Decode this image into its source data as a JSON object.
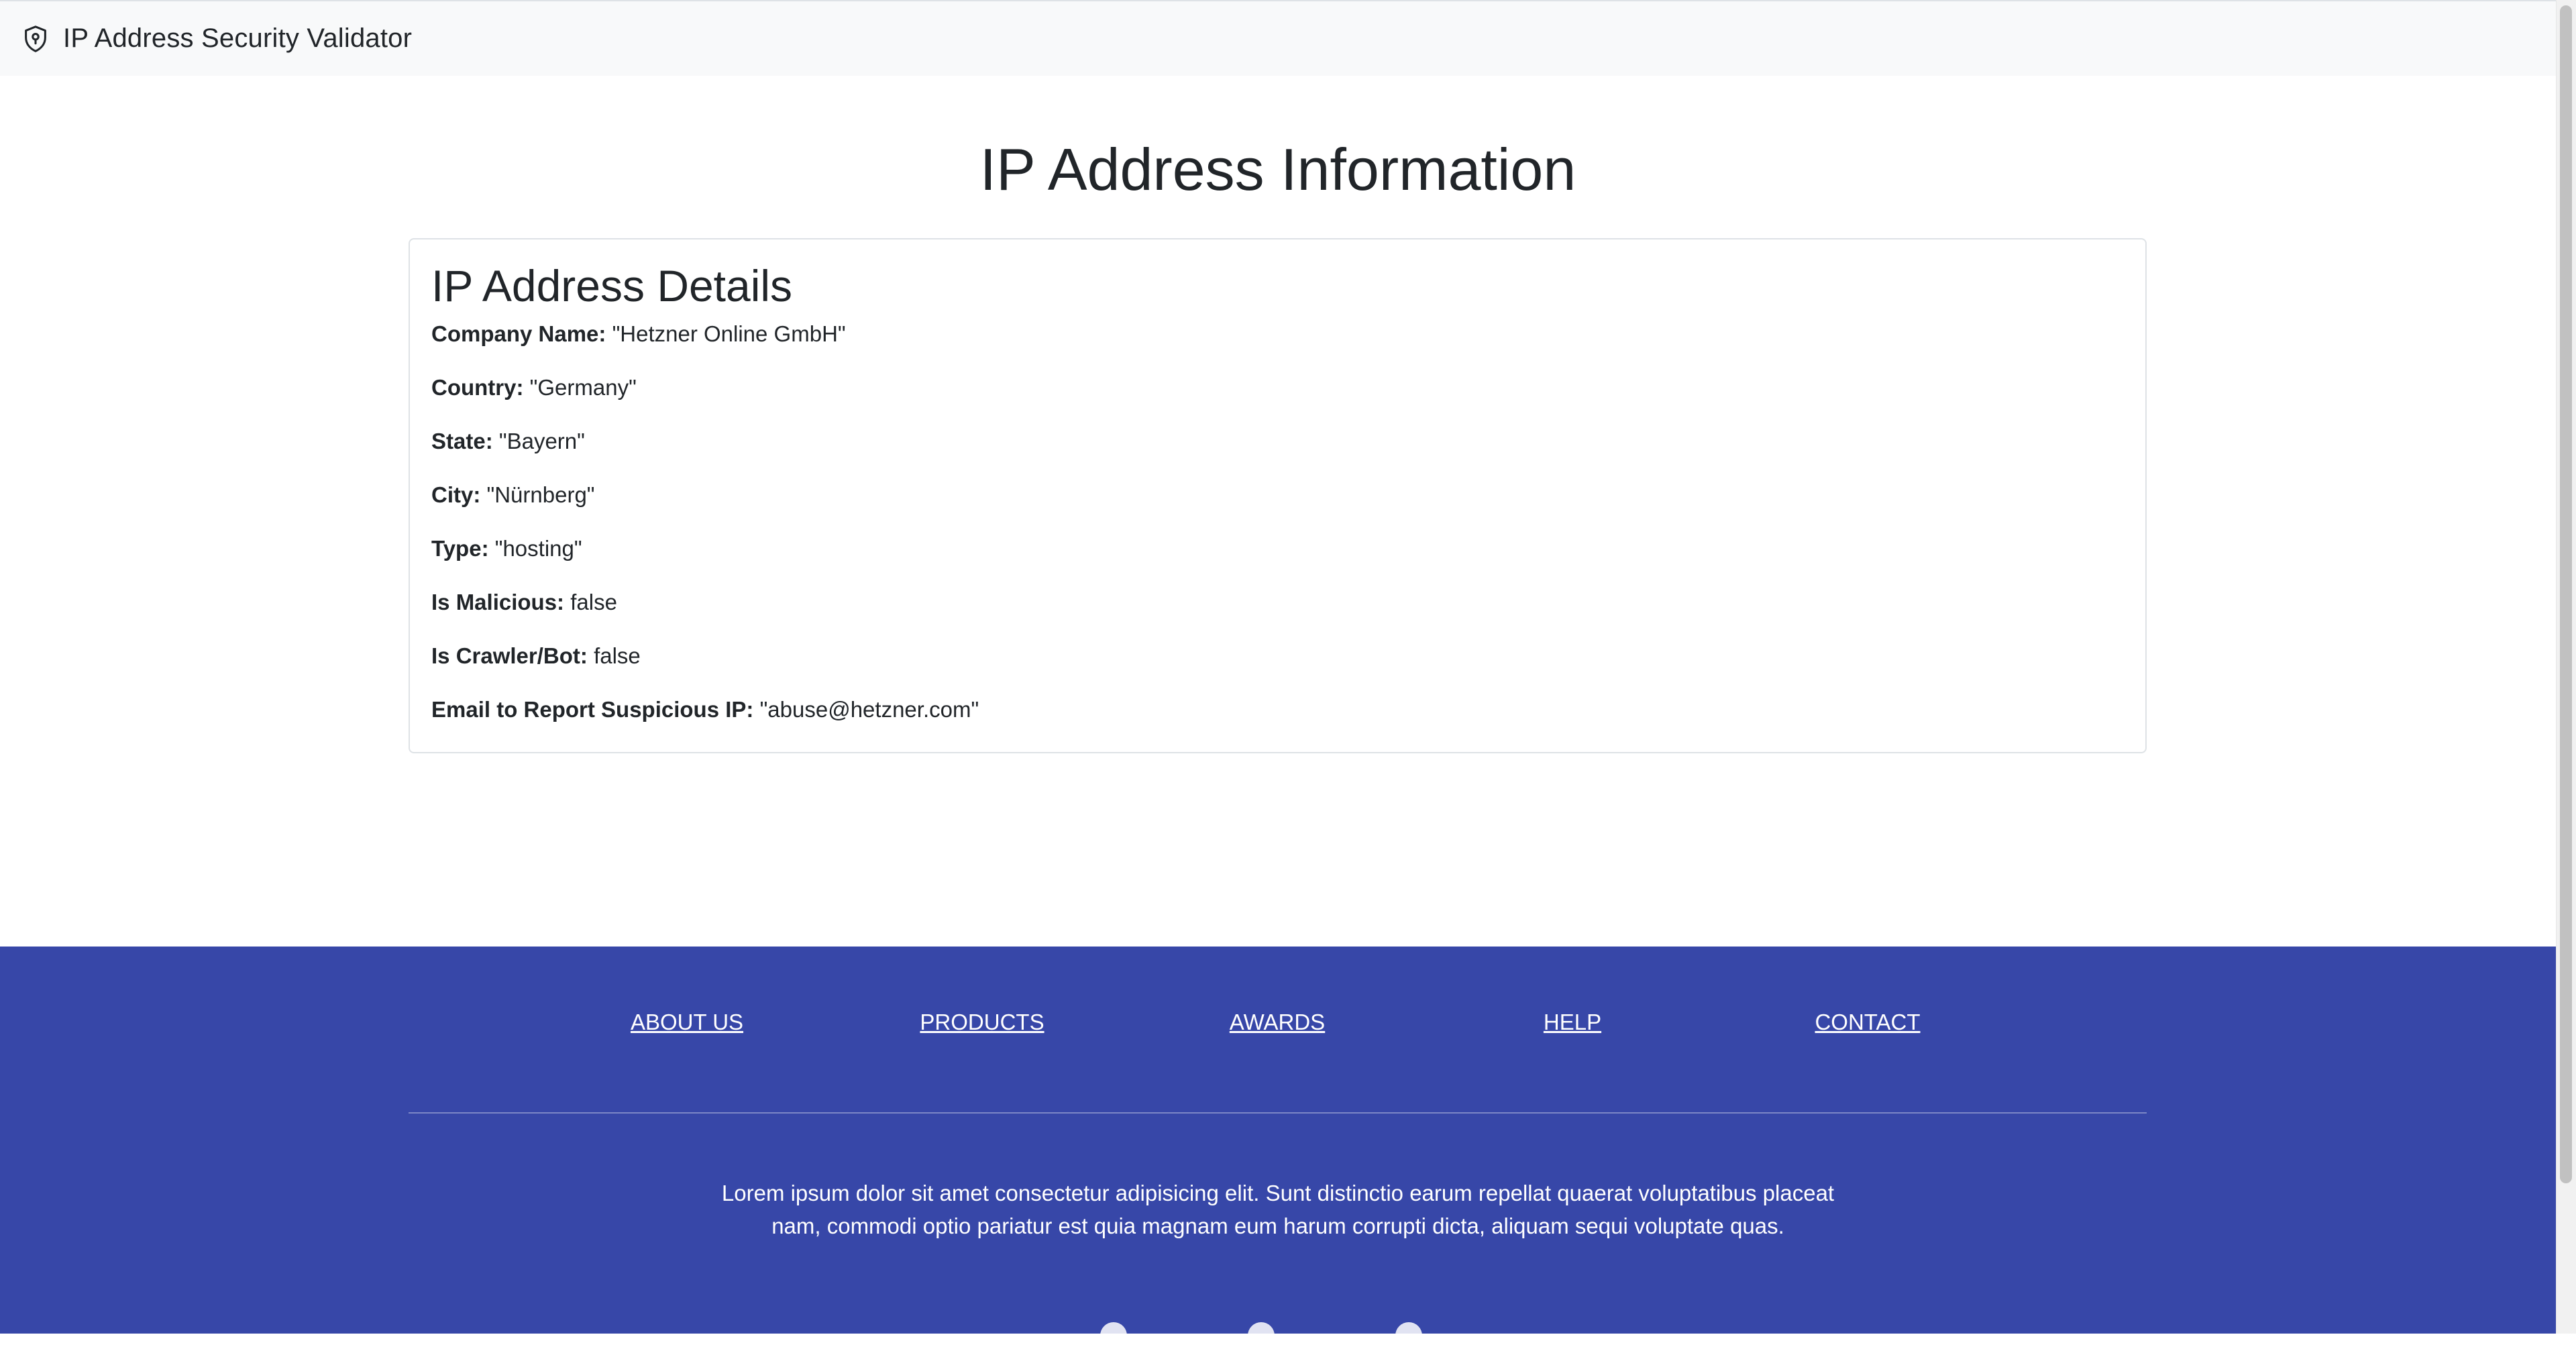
{
  "navbar": {
    "icon": "shield-location-icon",
    "title": "IP Address Security Validator"
  },
  "main": {
    "title": "IP Address Information",
    "card": {
      "title": "IP Address Details",
      "details": [
        {
          "label": "Company Name:",
          "value": "\"Hetzner Online GmbH\""
        },
        {
          "label": "Country:",
          "value": "\"Germany\""
        },
        {
          "label": "State:",
          "value": "\"Bayern\""
        },
        {
          "label": "City:",
          "value": "\"Nürnberg\""
        },
        {
          "label": "Type:",
          "value": "\"hosting\""
        },
        {
          "label": "Is Malicious:",
          "value": "false"
        },
        {
          "label": "Is Crawler/Bot:",
          "value": "false"
        },
        {
          "label": "Email to Report Suspicious IP:",
          "value": "\"abuse@hetzner.com\""
        }
      ]
    }
  },
  "footer": {
    "background_color": "#3747a8",
    "links": [
      {
        "label": "ABOUT US"
      },
      {
        "label": "PRODUCTS"
      },
      {
        "label": "AWARDS"
      },
      {
        "label": "HELP"
      },
      {
        "label": "CONTACT"
      }
    ],
    "text_line1": "Lorem ipsum dolor sit amet consectetur adipisicing elit. Sunt distinctio earum repellat quaerat voluptatibus placeat",
    "text_line2": "nam, commodi optio pariatur est quia magnam eum harum corrupti dicta, aliquam sequi voluptate quas."
  }
}
